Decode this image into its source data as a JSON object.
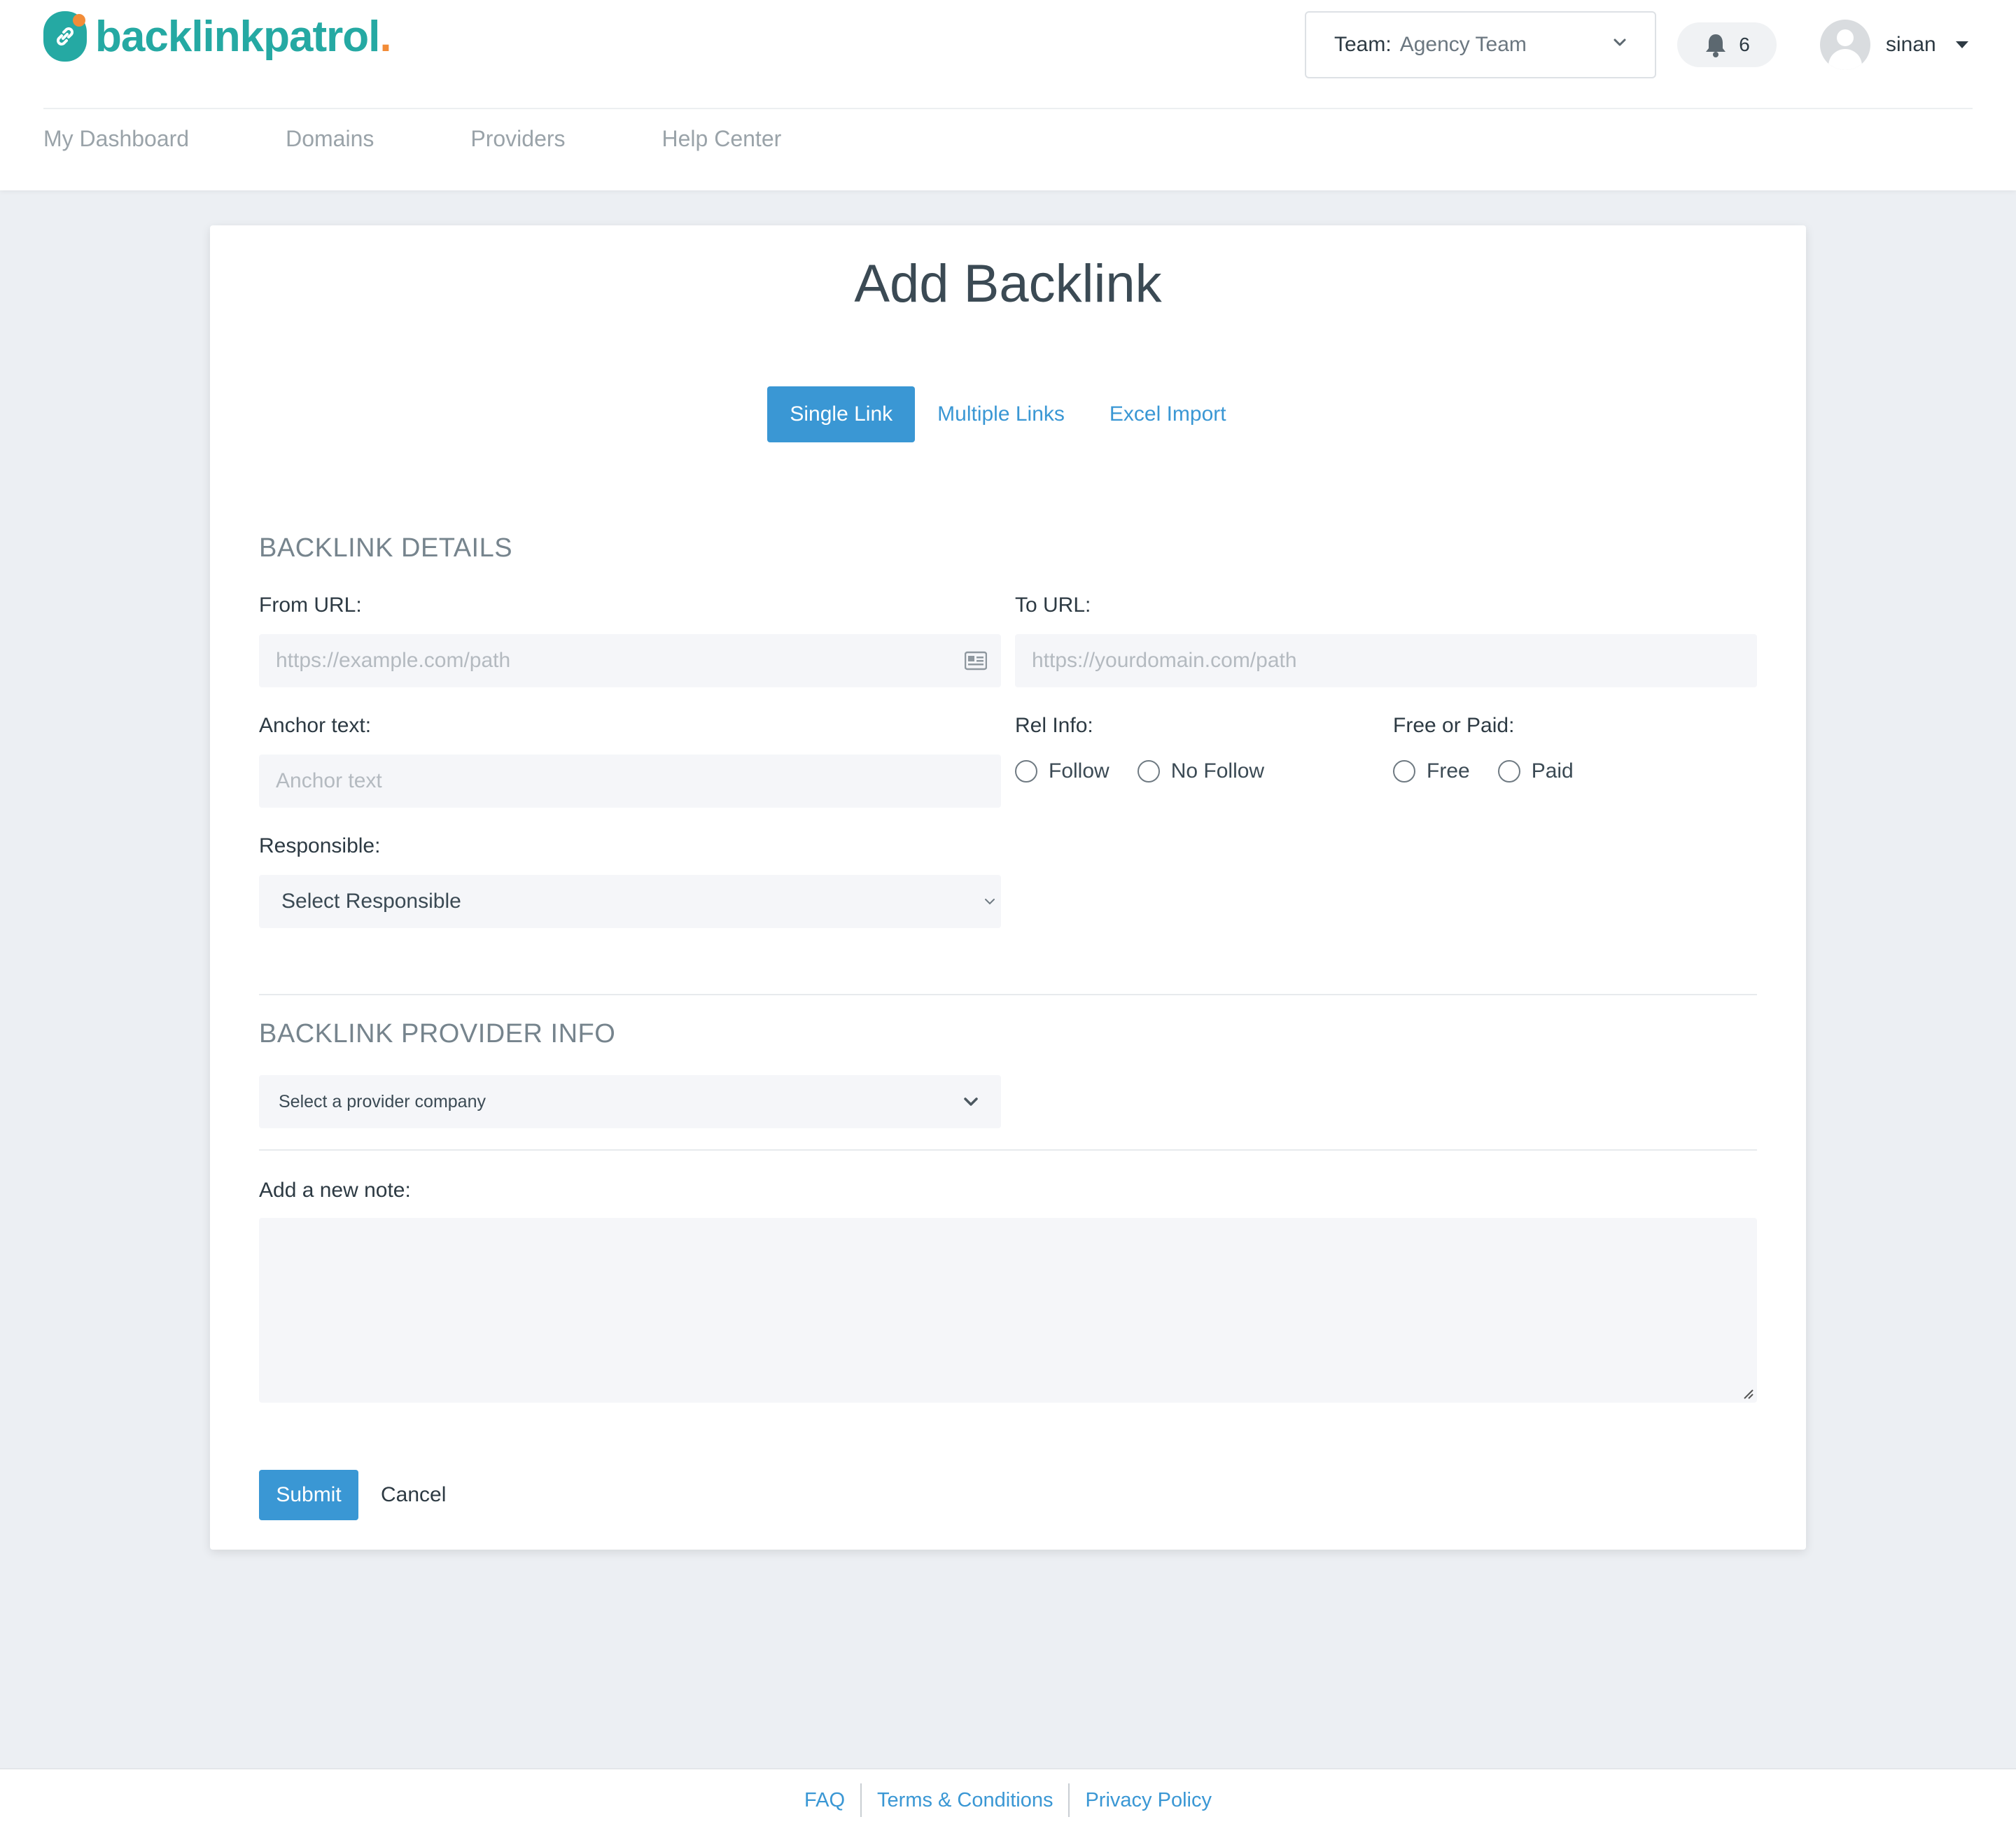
{
  "app": {
    "logo_text": "backlinkpatrol",
    "logo_period": ".",
    "brand_color": "#25a9a3",
    "accent_color": "#3a97d4",
    "logo_dot_color": "#f28c38"
  },
  "header": {
    "team_label": "Team:",
    "team_value": "Agency Team",
    "notifications_count": "6",
    "username": "sinan"
  },
  "nav": {
    "items": [
      {
        "label": "My Dashboard"
      },
      {
        "label": "Domains"
      },
      {
        "label": "Providers"
      },
      {
        "label": "Help Center"
      }
    ]
  },
  "page": {
    "title": "Add Backlink",
    "tabs": [
      {
        "label": "Single Link",
        "active": true
      },
      {
        "label": "Multiple Links",
        "active": false
      },
      {
        "label": "Excel Import",
        "active": false
      }
    ]
  },
  "backlink_details": {
    "section_title": "BACKLINK DETAILS",
    "from_url_label": "From URL:",
    "from_url_placeholder": "https://example.com/path",
    "to_url_label": "To URL:",
    "to_url_placeholder": "https://yourdomain.com/path",
    "anchor_label": "Anchor text:",
    "anchor_placeholder": "Anchor text",
    "rel_label": "Rel Info:",
    "rel_options": [
      "Follow",
      "No Follow"
    ],
    "paid_label": "Free or Paid:",
    "paid_options": [
      "Free",
      "Paid"
    ],
    "responsible_label": "Responsible:",
    "responsible_value": "Select Responsible"
  },
  "provider_info": {
    "section_title": "BACKLINK PROVIDER INFO",
    "provider_value": "Select a provider company"
  },
  "note": {
    "label": "Add a new note:",
    "value": ""
  },
  "actions": {
    "submit_label": "Submit",
    "cancel_label": "Cancel"
  },
  "footer": {
    "links": [
      "FAQ",
      "Terms & Conditions",
      "Privacy Policy"
    ]
  }
}
